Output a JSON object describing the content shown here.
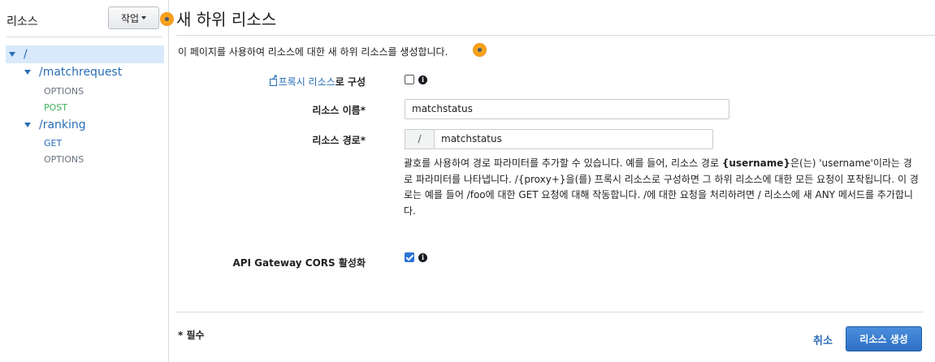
{
  "sidebar": {
    "title": "리소스",
    "actions_label": "작업",
    "tree": [
      {
        "path": "/",
        "selected": true
      },
      {
        "path": "/matchrequest",
        "methods": [
          "OPTIONS",
          "POST"
        ]
      },
      {
        "path": "/ranking",
        "methods": [
          "GET",
          "OPTIONS"
        ]
      }
    ]
  },
  "main": {
    "title": "새 하위 리소스",
    "description": "이 페이지를 사용하여 리소스에 대한 새 하위 리소스를 생성합니다.",
    "proxy": {
      "link_text": "프록시 리소스",
      "suffix": "로 구성",
      "checked": false
    },
    "resource_name": {
      "label": "리소스 이름*",
      "value": "matchstatus"
    },
    "resource_path": {
      "label": "리소스 경로*",
      "prefix": "/",
      "value": "matchstatus"
    },
    "help": {
      "p1": "괄호를 사용하여 경로 파라미터를 추가할 수 있습니다. 예를 들어, 리소스 경로 ",
      "bold": "{username}",
      "p2": "은(는) 'username'이라는 경로 파라미터를 나타냅니다. /{proxy+}을(를) 프록시 리소스로 구성하면 그 하위 리소스에 대한 모든 요청이 포착됩니다. 이 경로는 예를 들어 /foo에 대한 GET 요청에 대해 작동합니다. /에 대한 요청을 처리하려면 / 리소스에 새 ANY 메서드를 추가합니다."
    },
    "cors": {
      "label": "API Gateway CORS 활성화",
      "checked": true
    },
    "required_note": "* 필수",
    "cancel_label": "취소",
    "create_label": "리소스 생성"
  },
  "icons": {
    "info": "info-icon",
    "external_link": "external-link-icon",
    "help_dot": "info-bubble-icon"
  },
  "colors": {
    "link": "#2a6db6",
    "primary_button": "#2d6fc4",
    "selected_row": "#d8e9fb",
    "post_method": "#3fb05c",
    "help_dot": "#f7a21b"
  }
}
